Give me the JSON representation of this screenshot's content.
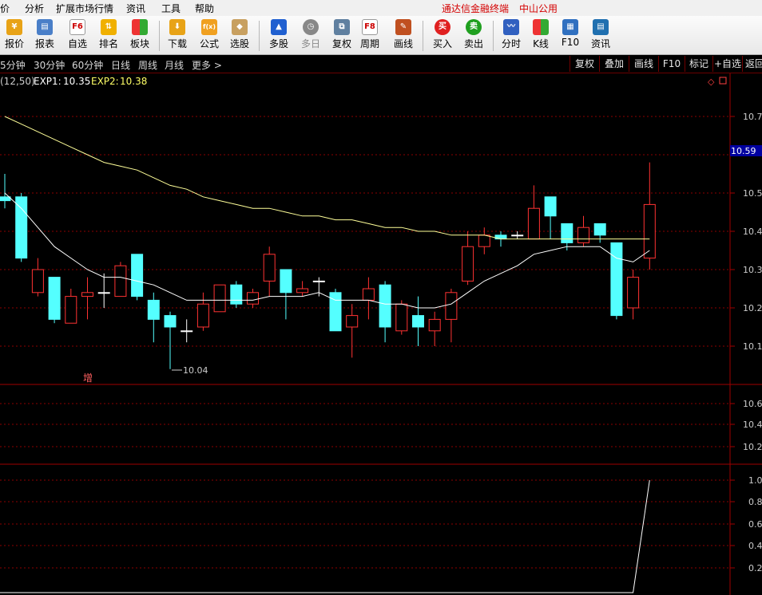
{
  "menubar": {
    "items": [
      "价",
      "分析",
      "扩展市场行情",
      "资讯",
      "工具",
      "帮助"
    ],
    "app_title": "通达信金融终端",
    "stock_name": "中山公用"
  },
  "toolbar": {
    "buttons": [
      {
        "label": "报价",
        "icon": "yen-icon"
      },
      {
        "label": "报表",
        "icon": "report-icon"
      },
      {
        "label": "自选",
        "icon": "f6-icon"
      },
      {
        "label": "排名",
        "icon": "rank-icon"
      },
      {
        "label": "板块",
        "icon": "sector-icon"
      },
      {
        "label": "下载",
        "icon": "download-icon"
      },
      {
        "label": "公式",
        "icon": "formula-icon"
      },
      {
        "label": "选股",
        "icon": "pick-stock-icon"
      },
      {
        "label": "多股",
        "icon": "multi-stock-icon"
      },
      {
        "label": "多日",
        "icon": "clock-icon"
      },
      {
        "label": "复权",
        "icon": "restore-icon"
      },
      {
        "label": "周期",
        "icon": "f8-icon"
      },
      {
        "label": "画线",
        "icon": "pencil-icon"
      },
      {
        "label": "买入",
        "icon": "buy-icon",
        "icon_text": "买"
      },
      {
        "label": "卖出",
        "icon": "sell-icon",
        "icon_text": "卖"
      },
      {
        "label": "分时",
        "icon": "timeshare-icon"
      },
      {
        "label": "K线",
        "icon": "kline-icon"
      },
      {
        "label": "F10",
        "icon": "f10-icon"
      },
      {
        "label": "资讯",
        "icon": "news-icon"
      }
    ],
    "f6_text": "F6",
    "f8_text": "F8",
    "formula_text": "f(x)"
  },
  "periods": [
    "5分钟",
    "30分钟",
    "60分钟",
    "日线",
    "周线",
    "月线",
    "更多 >"
  ],
  "right_buttons": [
    "复权",
    "叠加",
    "画线",
    "F10",
    "标记",
    "+自选",
    "返回"
  ],
  "indicator": {
    "params": "(12,50)",
    "exp1_label": "EXP1:",
    "exp1_value": "10.35",
    "exp2_label": "EXP2:",
    "exp2_value": "10.38"
  },
  "price_axis": {
    "ticks": [
      "10.7",
      "10.5",
      "10.4",
      "10.3",
      "10.2",
      "10.1"
    ],
    "current_price": "10.59"
  },
  "low_marker": "10.04",
  "increase_marker": "增",
  "mid_axis_ticks": [
    "10.6",
    "10.4",
    "10.2"
  ],
  "bottom_axis_ticks": [
    "1.0",
    "0.8",
    "0.6",
    "0.4",
    "0.2"
  ],
  "colors": {
    "up": "#ff3232",
    "down": "#54ffff",
    "flat": "#ffffff",
    "exp1": "#ffffff",
    "exp2": "#ffff99",
    "grid": "#8b0000",
    "current_price_bg": "#0000a0"
  },
  "chart_data": {
    "type": "candlestick",
    "ylim": [
      10.0,
      10.75
    ],
    "candles": [
      {
        "o": 10.49,
        "c": 10.48,
        "h": 10.55,
        "l": 10.46
      },
      {
        "o": 10.49,
        "c": 10.33,
        "h": 10.5,
        "l": 10.32
      },
      {
        "o": 10.24,
        "c": 10.3,
        "h": 10.33,
        "l": 10.23
      },
      {
        "o": 10.28,
        "c": 10.17,
        "h": 10.28,
        "l": 10.16
      },
      {
        "o": 10.16,
        "c": 10.23,
        "h": 10.25,
        "l": 10.16
      },
      {
        "o": 10.23,
        "c": 10.24,
        "h": 10.28,
        "l": 10.17
      },
      {
        "o": 10.24,
        "c": 10.24,
        "h": 10.29,
        "l": 10.2
      },
      {
        "o": 10.23,
        "c": 10.31,
        "h": 10.32,
        "l": 10.23
      },
      {
        "o": 10.34,
        "c": 10.23,
        "h": 10.34,
        "l": 10.22
      },
      {
        "o": 10.22,
        "c": 10.17,
        "h": 10.24,
        "l": 10.11
      },
      {
        "o": 10.18,
        "c": 10.15,
        "h": 10.19,
        "l": 10.04
      },
      {
        "o": 10.14,
        "c": 10.14,
        "h": 10.17,
        "l": 10.11
      },
      {
        "o": 10.15,
        "c": 10.21,
        "h": 10.24,
        "l": 10.14
      },
      {
        "o": 10.19,
        "c": 10.26,
        "h": 10.26,
        "l": 10.19
      },
      {
        "o": 10.26,
        "c": 10.21,
        "h": 10.27,
        "l": 10.2
      },
      {
        "o": 10.21,
        "c": 10.24,
        "h": 10.25,
        "l": 10.2
      },
      {
        "o": 10.27,
        "c": 10.34,
        "h": 10.36,
        "l": 10.23
      },
      {
        "o": 10.3,
        "c": 10.24,
        "h": 10.3,
        "l": 10.17
      },
      {
        "o": 10.24,
        "c": 10.25,
        "h": 10.27,
        "l": 10.23
      },
      {
        "o": 10.27,
        "c": 10.27,
        "h": 10.28,
        "l": 10.23
      },
      {
        "o": 10.24,
        "c": 10.14,
        "h": 10.25,
        "l": 10.14
      },
      {
        "o": 10.15,
        "c": 10.18,
        "h": 10.21,
        "l": 10.07
      },
      {
        "o": 10.22,
        "c": 10.25,
        "h": 10.28,
        "l": 10.17
      },
      {
        "o": 10.26,
        "c": 10.15,
        "h": 10.27,
        "l": 10.11
      },
      {
        "o": 10.14,
        "c": 10.21,
        "h": 10.22,
        "l": 10.13
      },
      {
        "o": 10.18,
        "c": 10.15,
        "h": 10.23,
        "l": 10.1
      },
      {
        "o": 10.14,
        "c": 10.17,
        "h": 10.19,
        "l": 10.1
      },
      {
        "o": 10.17,
        "c": 10.24,
        "h": 10.25,
        "l": 10.11
      },
      {
        "o": 10.27,
        "c": 10.36,
        "h": 10.4,
        "l": 10.26
      },
      {
        "o": 10.36,
        "c": 10.39,
        "h": 10.41,
        "l": 10.34
      },
      {
        "o": 10.39,
        "c": 10.38,
        "h": 10.4,
        "l": 10.36
      },
      {
        "o": 10.39,
        "c": 10.39,
        "h": 10.4,
        "l": 10.38
      },
      {
        "o": 10.38,
        "c": 10.46,
        "h": 10.52,
        "l": 10.38
      },
      {
        "o": 10.49,
        "c": 10.44,
        "h": 10.49,
        "l": 10.38
      },
      {
        "o": 10.42,
        "c": 10.37,
        "h": 10.42,
        "l": 10.35
      },
      {
        "o": 10.37,
        "c": 10.41,
        "h": 10.44,
        "l": 10.36
      },
      {
        "o": 10.42,
        "c": 10.39,
        "h": 10.42,
        "l": 10.37
      },
      {
        "o": 10.37,
        "c": 10.18,
        "h": 10.37,
        "l": 10.17
      },
      {
        "o": 10.2,
        "c": 10.28,
        "h": 10.3,
        "l": 10.17
      },
      {
        "o": 10.33,
        "c": 10.47,
        "h": 10.58,
        "l": 10.3
      }
    ],
    "exp1": [
      10.5,
      10.46,
      10.41,
      10.36,
      10.33,
      10.3,
      10.28,
      10.28,
      10.27,
      10.26,
      10.24,
      10.22,
      10.22,
      10.22,
      10.22,
      10.22,
      10.23,
      10.23,
      10.23,
      10.24,
      10.22,
      10.22,
      10.22,
      10.21,
      10.21,
      10.2,
      10.2,
      10.21,
      10.24,
      10.27,
      10.29,
      10.31,
      10.34,
      10.35,
      10.36,
      10.36,
      10.36,
      10.33,
      10.32,
      10.35
    ],
    "exp2": [
      10.7,
      10.68,
      10.66,
      10.64,
      10.62,
      10.6,
      10.58,
      10.57,
      10.56,
      10.54,
      10.52,
      10.51,
      10.49,
      10.48,
      10.47,
      10.46,
      10.46,
      10.45,
      10.44,
      10.44,
      10.43,
      10.43,
      10.42,
      10.41,
      10.41,
      10.4,
      10.4,
      10.39,
      10.39,
      10.39,
      10.38,
      10.38,
      10.38,
      10.38,
      10.38,
      10.38,
      10.38,
      10.38,
      10.38,
      10.38
    ],
    "bottom_indicator": {
      "type": "line",
      "ylim": [
        0.1,
        1.05
      ],
      "values": [
        0,
        0,
        0,
        0,
        0,
        0,
        0,
        0,
        0,
        0,
        0,
        0,
        0,
        0,
        0,
        0,
        0,
        0,
        0,
        0,
        0,
        0,
        0,
        0,
        0,
        0,
        0,
        0,
        0,
        0,
        0,
        0,
        0,
        0,
        0,
        0,
        0,
        0,
        0,
        1.0
      ]
    }
  }
}
